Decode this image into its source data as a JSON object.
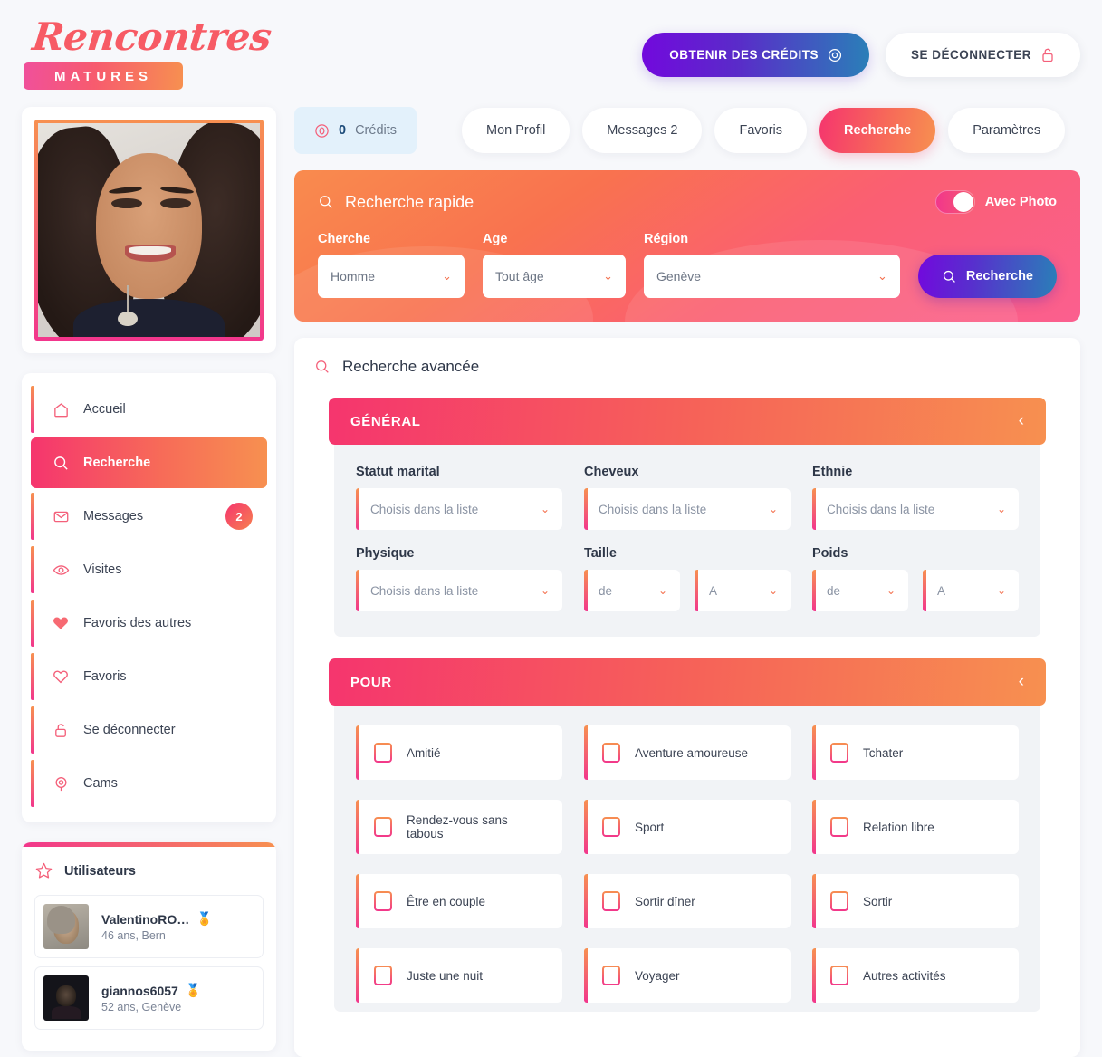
{
  "brand": {
    "script": "Rencontres",
    "bar": "MATURES"
  },
  "header": {
    "credits_button": "OBTENIR DES CRÉDITS",
    "logout_button": "SE DÉCONNECTER"
  },
  "credits": {
    "count": "0",
    "label": "Crédits"
  },
  "tabs": [
    {
      "label": "Mon Profil",
      "active": false
    },
    {
      "label": "Messages 2",
      "active": false
    },
    {
      "label": "Favoris",
      "active": false
    },
    {
      "label": "Recherche",
      "active": true
    },
    {
      "label": "Paramètres",
      "active": false
    }
  ],
  "sidebar": {
    "nav": [
      {
        "label": "Accueil",
        "icon": "home-icon",
        "active": false,
        "badge": ""
      },
      {
        "label": "Recherche",
        "icon": "search-icon",
        "active": true,
        "badge": ""
      },
      {
        "label": "Messages",
        "icon": "envelope-icon",
        "active": false,
        "badge": "2"
      },
      {
        "label": "Visites",
        "icon": "eye-icon",
        "active": false,
        "badge": ""
      },
      {
        "label": "Favoris des autres",
        "icon": "heart-filled-icon",
        "active": false,
        "badge": ""
      },
      {
        "label": "Favoris",
        "icon": "heart-outline-icon",
        "active": false,
        "badge": ""
      },
      {
        "label": "Se déconnecter",
        "icon": "unlock-icon",
        "active": false,
        "badge": ""
      },
      {
        "label": "Cams",
        "icon": "webcam-icon",
        "active": false,
        "badge": ""
      }
    ],
    "users_title": "Utilisateurs",
    "users": [
      {
        "name": "ValentinoRO…",
        "meta": "46 ans, Bern",
        "badge": "🏅"
      },
      {
        "name": "giannos6057",
        "meta": "52 ans, Genève",
        "badge": "🏅"
      }
    ]
  },
  "quick_search": {
    "title": "Recherche rapide",
    "toggle_label": "Avec Photo",
    "toggle_on": true,
    "fields": [
      {
        "label": "Cherche",
        "value": "Homme"
      },
      {
        "label": "Age",
        "value": "Tout âge"
      },
      {
        "label": "Région",
        "value": "Genève"
      }
    ],
    "search_button": "Recherche"
  },
  "advanced": {
    "title": "Recherche avancée",
    "general": {
      "heading": "GÉNÉRAL",
      "caret": "‹",
      "row1": [
        {
          "label": "Statut marital",
          "value": "Choisis dans la liste"
        },
        {
          "label": "Cheveux",
          "value": "Choisis dans la liste"
        },
        {
          "label": "Ethnie",
          "value": "Choisis dans la liste"
        }
      ],
      "physique": {
        "label": "Physique",
        "value": "Choisis dans la liste"
      },
      "taille": {
        "label": "Taille",
        "from": "de",
        "to": "A"
      },
      "poids": {
        "label": "Poids",
        "from": "de",
        "to": "A"
      }
    },
    "pour": {
      "heading": "POUR",
      "caret": "‹",
      "options": [
        "Amitié",
        "Aventure amoureuse",
        "Tchater",
        "Rendez-vous sans tabous",
        "Sport",
        "Relation libre",
        "Être en couple",
        "Sortir dîner",
        "Sortir",
        "Juste une nuit",
        "Voyager",
        "Autres activités"
      ]
    }
  },
  "colors": {
    "pink": "#f5356e",
    "orange": "#f79050",
    "purple": "#7209dd",
    "teal": "#2a7fb8",
    "bg": "#f7f8fb"
  }
}
